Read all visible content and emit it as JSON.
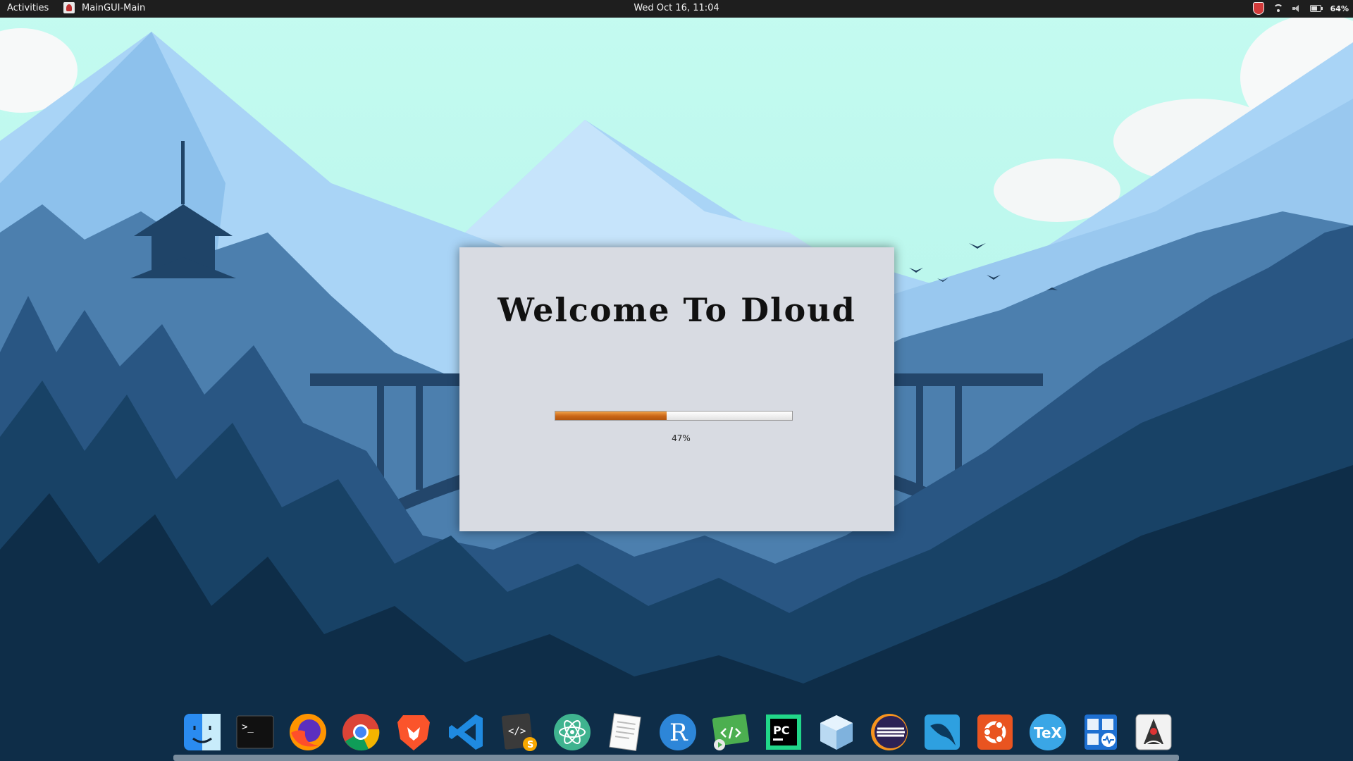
{
  "topbar": {
    "activities_label": "Activities",
    "app_name": "MainGUI-Main",
    "clock": "Wed Oct 16, 11:04",
    "battery_percent": "64%",
    "battery_level": 0.64
  },
  "splash": {
    "title": "Welcome To Dloud",
    "progress_value": 47,
    "progress_label": "47%",
    "accent_color": "#c96516"
  },
  "dock": {
    "items": [
      {
        "name": "finder-icon"
      },
      {
        "name": "terminal-icon",
        "glyph": ">_"
      },
      {
        "name": "firefox-icon"
      },
      {
        "name": "chrome-icon"
      },
      {
        "name": "brave-icon"
      },
      {
        "name": "vscode-icon"
      },
      {
        "name": "sublime-text-icon"
      },
      {
        "name": "atom-icon"
      },
      {
        "name": "text-editor-icon"
      },
      {
        "name": "r-icon",
        "glyph": "R"
      },
      {
        "name": "code-player-icon"
      },
      {
        "name": "pycharm-icon",
        "glyph": "PC"
      },
      {
        "name": "cube-icon"
      },
      {
        "name": "eclipse-icon"
      },
      {
        "name": "mysql-workbench-icon"
      },
      {
        "name": "ubuntu-icon"
      },
      {
        "name": "tex-icon",
        "glyph": "TeX"
      },
      {
        "name": "system-tools-icon"
      },
      {
        "name": "java-icon"
      }
    ]
  }
}
